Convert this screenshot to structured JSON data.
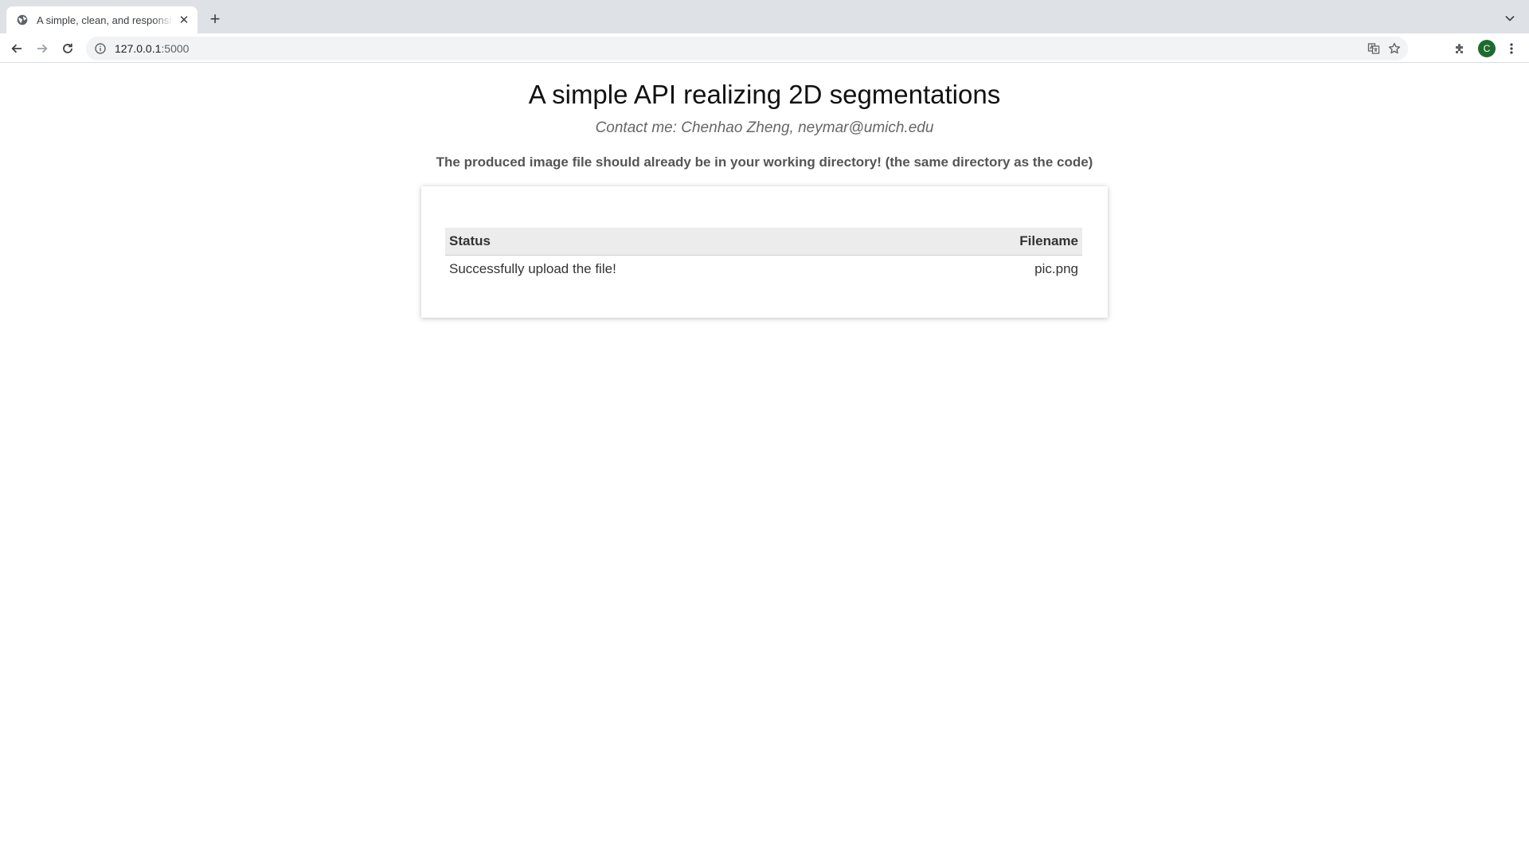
{
  "browser": {
    "tab_title": "A simple, clean, and responsive",
    "tab_close_glyph": "✕",
    "new_tab_glyph": "+",
    "url_host": "127.0.0.1",
    "url_port": ":5000",
    "avatar_letter": "C",
    "icons": [
      "globe-icon",
      "close-icon",
      "plus-icon",
      "chevron-down-icon",
      "back-arrow-icon",
      "forward-arrow-icon",
      "reload-icon",
      "info-icon",
      "translate-icon",
      "star-icon",
      "extensions-puzzle-icon",
      "more-vert-icon"
    ]
  },
  "page": {
    "title": "A simple API realizing 2D segmentations",
    "contact": "Contact me: Chenhao Zheng, neymar@umich.edu",
    "notice": "The produced image file should already be in your working directory! (the same directory as the code)",
    "table": {
      "headers": [
        "Status",
        "Filename"
      ],
      "rows": [
        [
          "Successfully upload the file!",
          "pic.png"
        ]
      ]
    }
  },
  "colors": {
    "avatar_bg": "#1e6b2f",
    "tabstrip_bg": "#dee1e6",
    "header_row_bg": "#ececec"
  }
}
